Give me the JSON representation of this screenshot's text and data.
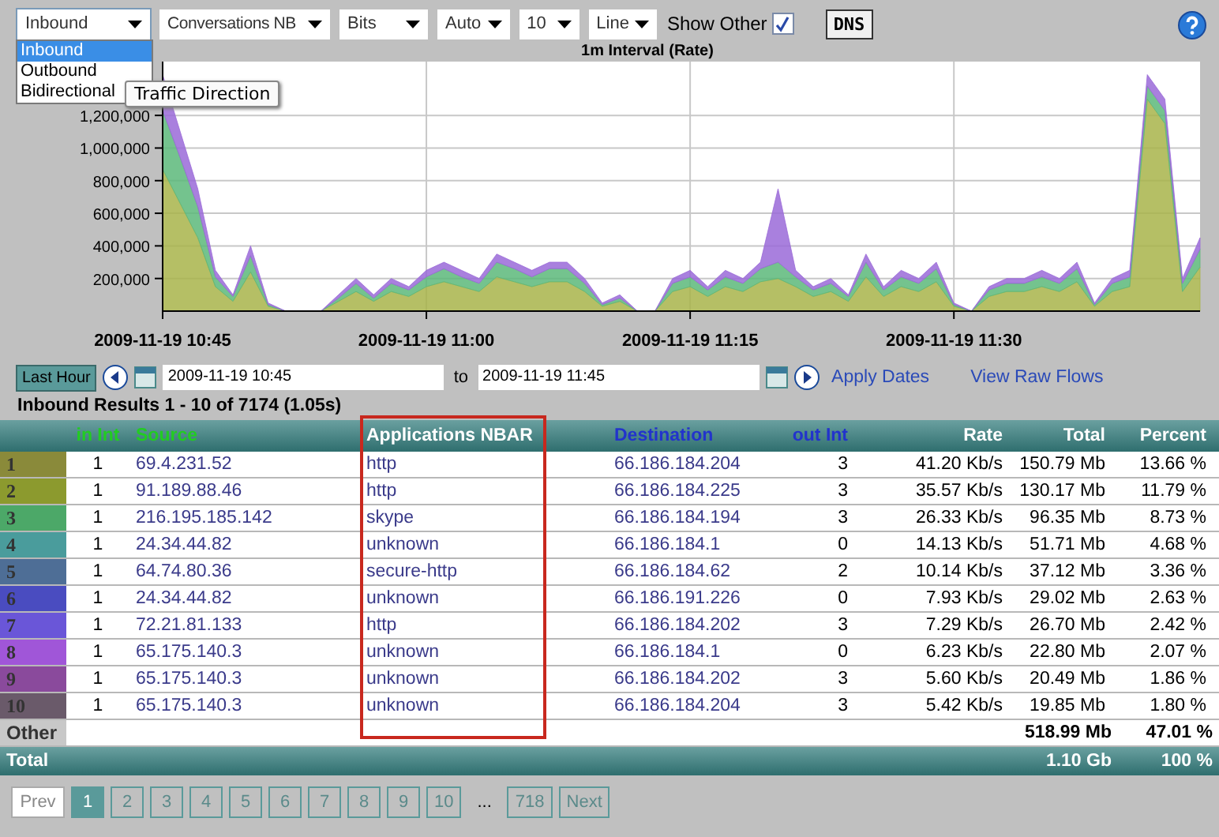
{
  "toolbar": {
    "selects": [
      {
        "value": "Inbound",
        "open": true
      },
      {
        "value": "Conversations NB",
        "open": false
      },
      {
        "value": "Bits",
        "open": false
      },
      {
        "value": "Auto",
        "open": false
      },
      {
        "value": "10",
        "open": false
      },
      {
        "value": "Line",
        "open": false
      }
    ],
    "direction_options": [
      {
        "label": "Inbound",
        "selected": true
      },
      {
        "label": "Outbound",
        "selected": false
      },
      {
        "label": "Bidirectional",
        "selected": false
      }
    ],
    "tooltip": "Traffic Direction",
    "show_other": {
      "label": "Show Other",
      "checked": true
    },
    "dns_button": "DNS"
  },
  "chart": {
    "chart_data": {
      "type": "area",
      "stacked": true,
      "title": "1m Interval (Rate)",
      "categories": [
        "2009-11-19 10:45",
        null,
        null,
        null,
        null,
        null,
        null,
        null,
        null,
        null,
        null,
        null,
        null,
        null,
        null,
        "2009-11-19 11:00",
        null,
        null,
        null,
        null,
        null,
        null,
        null,
        null,
        null,
        null,
        null,
        null,
        null,
        null,
        "2009-11-19 11:15",
        null,
        null,
        null,
        null,
        null,
        null,
        null,
        null,
        null,
        null,
        null,
        null,
        null,
        null,
        "2009-11-19 11:30",
        null,
        null,
        null,
        null,
        null,
        null,
        null,
        null,
        null,
        null,
        null,
        null,
        null,
        null
      ],
      "ylim": [
        0,
        1530000
      ],
      "grid": true,
      "yticks": [
        {
          "value": 200000,
          "label": "200,000"
        },
        {
          "value": 400000,
          "label": "400,000"
        },
        {
          "value": 600000,
          "label": "600,000"
        },
        {
          "value": 800000,
          "label": "800,000"
        },
        {
          "value": 1000000,
          "label": "1,000,000"
        },
        {
          "value": 1200000,
          "label": "1,200,000"
        }
      ],
      "series": [
        {
          "color": "#a8b44a",
          "values": [
            870000,
            660000,
            450000,
            150000,
            60000,
            240000,
            30000,
            0,
            0,
            0,
            60000,
            120000,
            60000,
            120000,
            90000,
            150000,
            180000,
            150000,
            120000,
            210000,
            180000,
            150000,
            180000,
            180000,
            120000,
            30000,
            60000,
            0,
            0,
            120000,
            150000,
            90000,
            150000,
            120000,
            180000,
            200000,
            150000,
            90000,
            120000,
            60000,
            210000,
            90000,
            150000,
            120000,
            180000,
            30000,
            0,
            90000,
            120000,
            120000,
            150000,
            120000,
            180000,
            30000,
            120000,
            150000,
            1300000,
            1150000,
            120000,
            270000
          ]
        },
        {
          "color": "#5cb87a",
          "values": [
            360000,
            280000,
            190000,
            60000,
            30000,
            100000,
            10000,
            0,
            0,
            0,
            20000,
            50000,
            20000,
            50000,
            40000,
            60000,
            80000,
            60000,
            50000,
            90000,
            80000,
            60000,
            80000,
            80000,
            50000,
            10000,
            20000,
            0,
            0,
            50000,
            60000,
            40000,
            60000,
            50000,
            80000,
            100000,
            60000,
            40000,
            50000,
            30000,
            90000,
            40000,
            60000,
            50000,
            80000,
            10000,
            0,
            40000,
            50000,
            50000,
            60000,
            50000,
            80000,
            10000,
            50000,
            60000,
            80000,
            80000,
            50000,
            110000
          ]
        },
        {
          "color": "#9a6ad8",
          "values": [
            220000,
            160000,
            110000,
            40000,
            10000,
            60000,
            10000,
            0,
            0,
            0,
            20000,
            30000,
            20000,
            30000,
            20000,
            40000,
            40000,
            40000,
            30000,
            50000,
            40000,
            40000,
            40000,
            40000,
            30000,
            10000,
            20000,
            0,
            0,
            30000,
            40000,
            20000,
            40000,
            30000,
            40000,
            450000,
            40000,
            20000,
            30000,
            10000,
            50000,
            20000,
            40000,
            30000,
            40000,
            10000,
            0,
            20000,
            30000,
            30000,
            40000,
            30000,
            40000,
            10000,
            30000,
            40000,
            70000,
            70000,
            30000,
            70000
          ]
        }
      ]
    }
  },
  "date_range": {
    "preset": "Last Hour",
    "from": "2009-11-19 10:45",
    "to_label": "to",
    "to": "2009-11-19 11:45",
    "apply": "Apply Dates",
    "raw_flows": "View Raw Flows"
  },
  "results_title": "Inbound Results 1 - 10 of 7174 (1.05s)",
  "table": {
    "columns": [
      {
        "label": "in Int",
        "color": "#22cc22"
      },
      {
        "label": "Source",
        "color": "#22cc22"
      },
      {
        "label": "Applications NBAR",
        "color": "#ffffff"
      },
      {
        "label": "Destination",
        "color": "#2233cc"
      },
      {
        "label": "out Int",
        "color": "#2233cc"
      },
      {
        "label": "Rate",
        "color": "#ffffff"
      },
      {
        "label": "Total",
        "color": "#ffffff"
      },
      {
        "label": "Percent",
        "color": "#ffffff"
      }
    ],
    "rows": [
      {
        "rank": "1",
        "color": "#8a8a3a",
        "in_int": "1",
        "source": "69.4.231.52",
        "app": "http",
        "destination": "66.186.184.204",
        "out_int": "3",
        "rate": "41.20 Kb/s",
        "total": "150.79 Mb",
        "percent": "13.66 %"
      },
      {
        "rank": "2",
        "color": "#8c9a2e",
        "in_int": "1",
        "source": "91.189.88.46",
        "app": "http",
        "destination": "66.186.184.225",
        "out_int": "3",
        "rate": "35.57 Kb/s",
        "total": "130.17 Mb",
        "percent": "11.79 %"
      },
      {
        "rank": "3",
        "color": "#4ca868",
        "in_int": "1",
        "source": "216.195.185.142",
        "app": "skype",
        "destination": "66.186.184.194",
        "out_int": "3",
        "rate": "26.33 Kb/s",
        "total": "96.35 Mb",
        "percent": "8.73 %"
      },
      {
        "rank": "4",
        "color": "#4a9c9c",
        "in_int": "1",
        "source": "24.34.44.82",
        "app": "unknown",
        "destination": "66.186.184.1",
        "out_int": "0",
        "rate": "14.13 Kb/s",
        "total": "51.71 Mb",
        "percent": "4.68 %"
      },
      {
        "rank": "5",
        "color": "#4e6e96",
        "in_int": "1",
        "source": "64.74.80.36",
        "app": "secure-http",
        "destination": "66.186.184.62",
        "out_int": "2",
        "rate": "10.14 Kb/s",
        "total": "37.12 Mb",
        "percent": "3.36 %"
      },
      {
        "rank": "6",
        "color": "#4a4cc0",
        "in_int": "1",
        "source": "24.34.44.82",
        "app": "unknown",
        "destination": "66.186.191.226",
        "out_int": "0",
        "rate": "7.93 Kb/s",
        "total": "29.02 Mb",
        "percent": "2.63 %"
      },
      {
        "rank": "7",
        "color": "#6a56d8",
        "in_int": "1",
        "source": "72.21.81.133",
        "app": "http",
        "destination": "66.186.184.202",
        "out_int": "3",
        "rate": "7.29 Kb/s",
        "total": "26.70 Mb",
        "percent": "2.42 %"
      },
      {
        "rank": "8",
        "color": "#a056d8",
        "in_int": "1",
        "source": "65.175.140.3",
        "app": "unknown",
        "destination": "66.186.184.1",
        "out_int": "0",
        "rate": "6.23 Kb/s",
        "total": "22.80 Mb",
        "percent": "2.07 %"
      },
      {
        "rank": "9",
        "color": "#8a4a9c",
        "in_int": "1",
        "source": "65.175.140.3",
        "app": "unknown",
        "destination": "66.186.184.202",
        "out_int": "3",
        "rate": "5.60 Kb/s",
        "total": "20.49 Mb",
        "percent": "1.86 %"
      },
      {
        "rank": "10",
        "color": "#6a5a6a",
        "in_int": "1",
        "source": "65.175.140.3",
        "app": "unknown",
        "destination": "66.186.184.204",
        "out_int": "3",
        "rate": "5.42 Kb/s",
        "total": "19.85 Mb",
        "percent": "1.80 %"
      }
    ],
    "other": {
      "label": "Other",
      "total": "518.99 Mb",
      "percent": "47.01 %"
    },
    "total": {
      "label": "Total",
      "total": "1.10 Gb",
      "percent": "100 %"
    }
  },
  "pagination": {
    "prev": "Prev",
    "pages": [
      {
        "label": "1",
        "selected": true
      },
      {
        "label": "2",
        "selected": false
      },
      {
        "label": "3",
        "selected": false
      },
      {
        "label": "4",
        "selected": false
      },
      {
        "label": "5",
        "selected": false
      },
      {
        "label": "6",
        "selected": false
      },
      {
        "label": "7",
        "selected": false
      },
      {
        "label": "8",
        "selected": false
      },
      {
        "label": "9",
        "selected": false
      },
      {
        "label": "10",
        "selected": false
      }
    ],
    "ellipsis": "...",
    "last": "718",
    "next": "Next"
  }
}
